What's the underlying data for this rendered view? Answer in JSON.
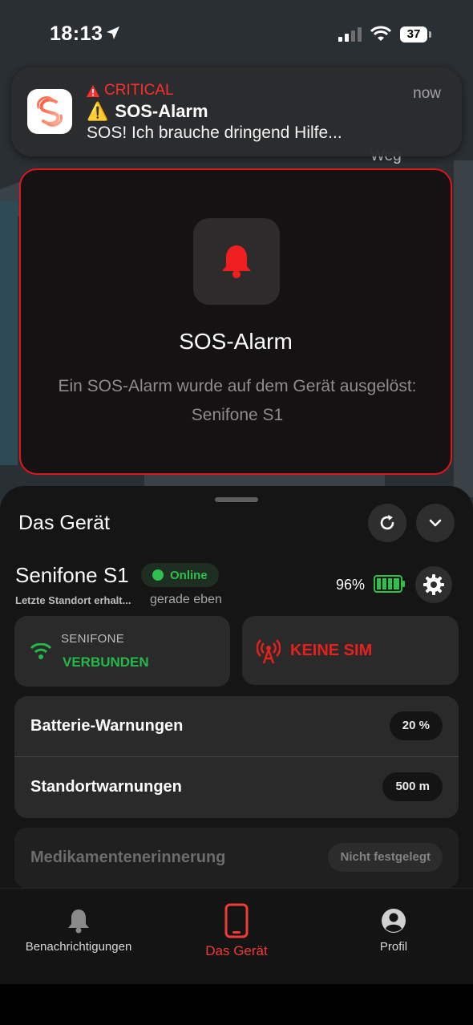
{
  "status_bar": {
    "time": "18:13",
    "battery": "37"
  },
  "notification": {
    "badge": "CRITICAL",
    "title": "SOS-Alarm",
    "body": "SOS! Ich brauche dringend Hilfe...",
    "time": "now",
    "warning_glyph": "⚠️",
    "critical_color": "#ff2d2d"
  },
  "map": {
    "label": "Weg"
  },
  "sos_card": {
    "title": "SOS-Alarm",
    "message": "Ein SOS-Alarm wurde auf dem Gerät ausgelöst: Senifone S1",
    "accent": "#e0161c"
  },
  "sheet": {
    "title": "Das Gerät",
    "device_name": "Senifone S1",
    "online_label": "Online",
    "location_label": "Letzte Standort erhalt...",
    "location_time": "gerade eben",
    "battery_percent": "96%",
    "battery_level": 0.96,
    "connection": {
      "label": "SENIFONE",
      "status": "VERBUNDEN"
    },
    "sim": {
      "status": "KEINE SIM"
    },
    "warnings": [
      {
        "label": "Batterie-Warnungen",
        "value": "20 %"
      },
      {
        "label": "Standortwarnungen",
        "value": "500 m"
      }
    ],
    "medication": {
      "label": "Medikamentenerinnerung",
      "value": "Nicht festgelegt"
    }
  },
  "tabs": [
    {
      "label": "Benachrichtigungen",
      "icon": "bell-icon",
      "active": false
    },
    {
      "label": "Das Gerät",
      "icon": "phone-icon",
      "active": true
    },
    {
      "label": "Profil",
      "icon": "profile-icon",
      "active": false
    }
  ],
  "colors": {
    "green": "#2fbf4c",
    "red": "#e5211d",
    "active_tab": "#ef3b36"
  }
}
